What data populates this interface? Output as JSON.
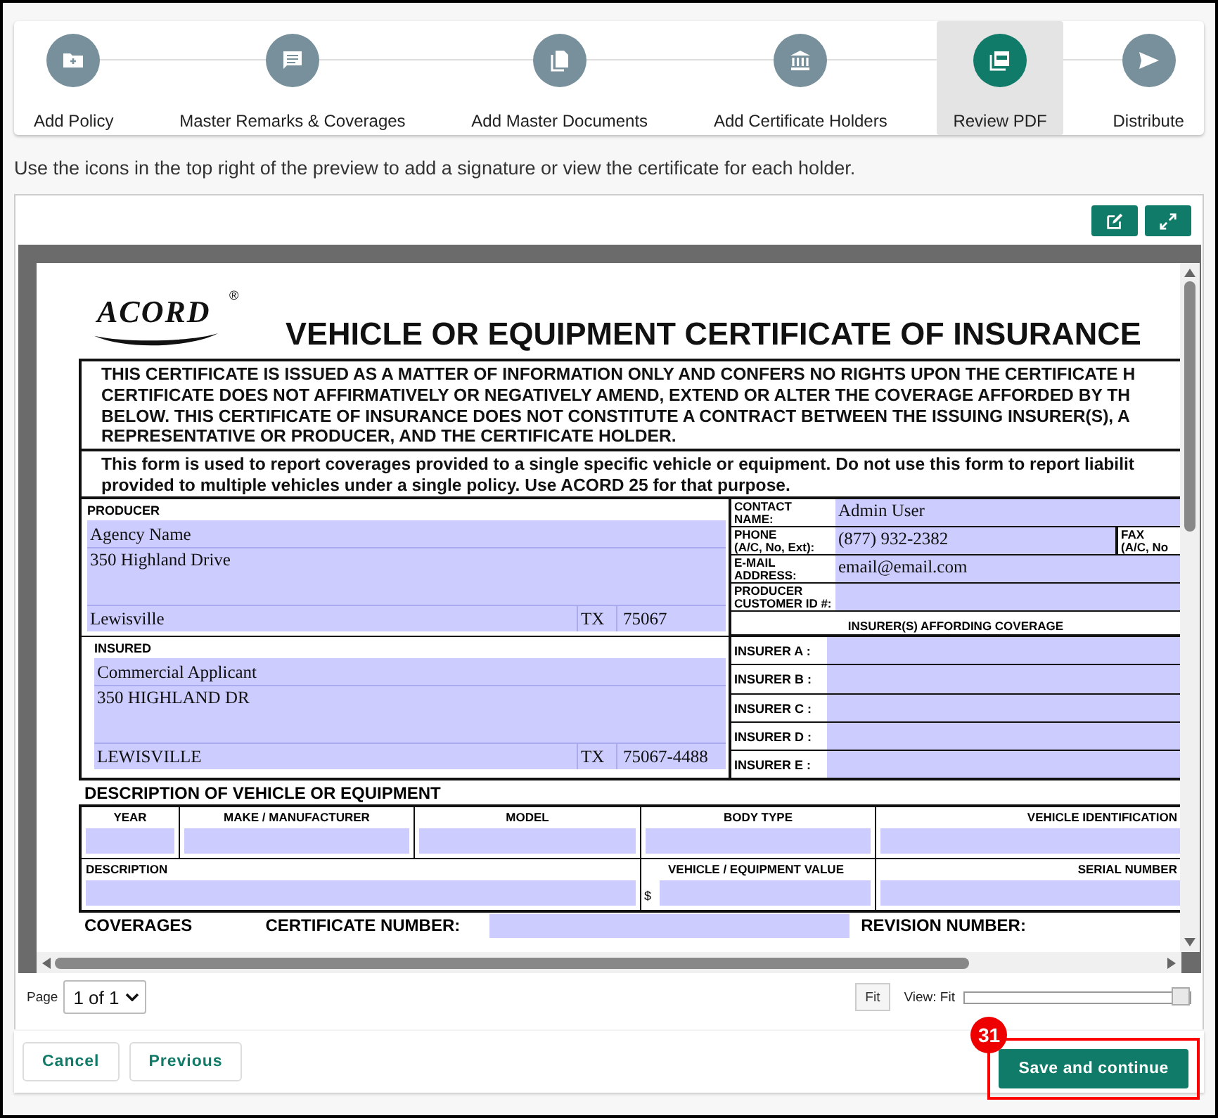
{
  "steps": [
    {
      "label": "Add Policy",
      "selected": false
    },
    {
      "label": "Master Remarks & Coverages",
      "selected": false
    },
    {
      "label": "Add Master Documents",
      "selected": false
    },
    {
      "label": "Add Certificate Holders",
      "selected": false
    },
    {
      "label": "Review PDF",
      "selected": true
    },
    {
      "label": "Distribute",
      "selected": false
    }
  ],
  "instruction": "Use the icons in the top right of the preview to add a signature or view the certificate for each holder.",
  "certificate": {
    "logo": "ACORD",
    "logo_mark": "®",
    "title": "VEHICLE OR EQUIPMENT CERTIFICATE OF INSURANCE",
    "disclaimer": [
      "THIS CERTIFICATE IS ISSUED AS A MATTER OF INFORMATION ONLY AND CONFERS NO RIGHTS UPON THE CERTIFICATE H",
      "CERTIFICATE DOES NOT AFFIRMATIVELY OR NEGATIVELY AMEND, EXTEND OR ALTER THE COVERAGE AFFORDED BY TH",
      "BELOW.  THIS CERTIFICATE OF INSURANCE DOES NOT CONSTITUTE A CONTRACT BETWEEN THE ISSUING INSURER(S), A",
      "REPRESENTATIVE OR PRODUCER, AND THE CERTIFICATE HOLDER."
    ],
    "notice": [
      "This form is used to report coverages provided to a single specific vehicle or equipment.  Do not use this form to report liabilit",
      "provided to multiple vehicles under a single policy.  Use ACORD 25 for that purpose."
    ],
    "producer": {
      "label": "PRODUCER",
      "name": "Agency Name",
      "address": "350 Highland Drive",
      "city": "Lewisville",
      "state": "TX",
      "zip": "75067"
    },
    "contact": [
      {
        "label": "CONTACT\nNAME:",
        "value": "Admin User"
      },
      {
        "label": "PHONE\n(A/C, No, Ext):",
        "value": "(877) 932-2382",
        "side_label": "FAX\n(A/C, No"
      },
      {
        "label": "E-MAIL\nADDRESS:",
        "value": "email@email.com"
      },
      {
        "label": "PRODUCER\nCUSTOMER ID #:"
      }
    ],
    "insurers_heading": "INSURER(S) AFFORDING COVERAGE",
    "insured": {
      "label": "INSURED",
      "name": "Commercial Applicant",
      "address": "350 HIGHLAND DR",
      "city": "LEWISVILLE",
      "state": "TX",
      "zip": "75067-4488"
    },
    "insurers": [
      "INSURER A :",
      "INSURER B :",
      "INSURER C :",
      "INSURER D :",
      "INSURER E :"
    ],
    "vehicle_heading": "DESCRIPTION OF VEHICLE OR EQUIPMENT",
    "vehicle_columns": [
      "YEAR",
      "MAKE / MANUFACTURER",
      "MODEL",
      "BODY TYPE",
      "VEHICLE IDENTIFICATION"
    ],
    "vehicle_row2": {
      "description": "DESCRIPTION",
      "value": "VEHICLE / EQUIPMENT VALUE",
      "currency": "$",
      "serial": "SERIAL NUMBER"
    },
    "coverages": "COVERAGES",
    "certificate_number": "CERTIFICATE NUMBER:",
    "revision_number": "REVISION NUMBER:"
  },
  "pager": {
    "label": "Page",
    "value": "1 of 1",
    "fit": "Fit",
    "view": "View: Fit",
    "level": 1
  },
  "buttons": {
    "cancel": "Cancel",
    "previous": "Previous",
    "save": "Save and continue",
    "badge": "31"
  }
}
